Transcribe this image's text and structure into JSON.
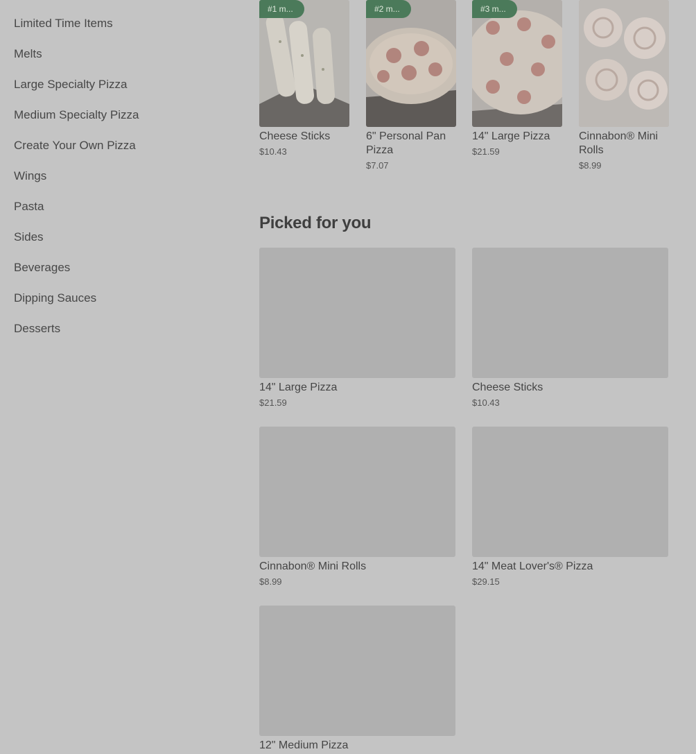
{
  "sidebar": {
    "items": [
      {
        "label": "Limited Time Items"
      },
      {
        "label": "Melts"
      },
      {
        "label": "Large Specialty Pizza"
      },
      {
        "label": "Medium Specialty Pizza"
      },
      {
        "label": "Create Your Own Pizza"
      },
      {
        "label": "Wings"
      },
      {
        "label": "Pasta"
      },
      {
        "label": "Sides"
      },
      {
        "label": "Beverages"
      },
      {
        "label": "Dipping Sauces"
      },
      {
        "label": "Desserts"
      }
    ]
  },
  "popular": [
    {
      "badge": "#1 m...",
      "name": "Cheese Sticks",
      "price": "$10.43",
      "image": "cheese-sticks-photo"
    },
    {
      "badge": "#2 m...",
      "name": "6\" Personal Pan Pizza",
      "price": "$7.07",
      "image": "personal-pan-pizza-photo"
    },
    {
      "badge": "#3 m...",
      "name": "14\" Large Pizza",
      "price": "$21.59",
      "image": "large-pizza-photo"
    },
    {
      "badge": "",
      "name": "Cinnabon® Mini Rolls",
      "price": "$8.99",
      "image": "cinnabon-rolls-photo"
    }
  ],
  "picked": {
    "title": "Picked for you",
    "items": [
      {
        "name": "14\" Large Pizza",
        "price": "$21.59"
      },
      {
        "name": "Cheese Sticks",
        "price": "$10.43"
      },
      {
        "name": "Cinnabon® Mini Rolls",
        "price": "$8.99"
      },
      {
        "name": "14\" Meat Lover's® Pizza",
        "price": "$29.15"
      },
      {
        "name": "12\" Medium Pizza",
        "price": ""
      }
    ]
  },
  "colors": {
    "overlay": "#c4c4c4",
    "badge": "#4b7a5a"
  }
}
